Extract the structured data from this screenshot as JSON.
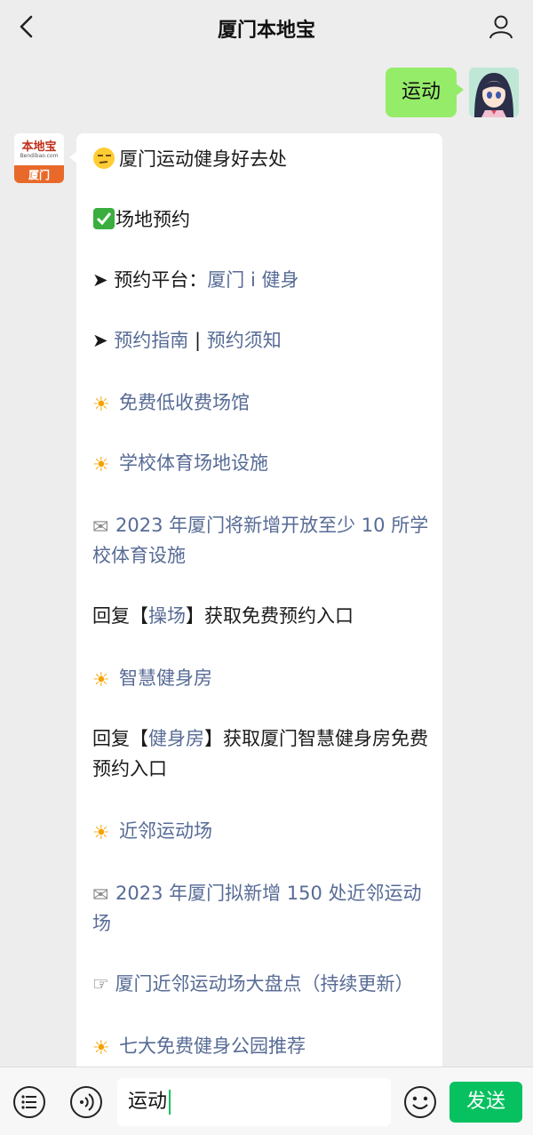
{
  "header": {
    "title": "厦门本地宝"
  },
  "outgoing": {
    "text": "运动"
  },
  "bot_avatar": {
    "top": "本地宝",
    "domain": "Bendibao.com",
    "city": "厦门"
  },
  "message": {
    "title": "厦门运动健身好去处",
    "booking_head": "场地预约",
    "platform_prefix": "预约平台：",
    "platform_link": "厦门 i 健身",
    "guide_link": "预约指南",
    "separator": "|",
    "notice_link": "预约须知",
    "free_venues": "免费低收费场馆",
    "school_head": "学校体育场地设施",
    "school_news": "2023 年厦门将新增开放至少 10 所学校体育设施",
    "reply1_pre": "回复【",
    "reply1_kw": "操场",
    "reply1_post": "】获取免费预约入口",
    "gym_head": "智慧健身房",
    "reply2_pre": "回复【",
    "reply2_kw": "健身房",
    "reply2_post": "】获取厦门智慧健身房免费预约入口",
    "near_head": "近邻运动场",
    "near_news": "2023 年厦门拟新增 150 处近邻运动场",
    "near_list": "厦门近邻运动场大盘点（持续更新）",
    "parks": "七大免费健身公园推荐"
  },
  "input": {
    "value": "运动"
  },
  "send": {
    "label": "发送"
  },
  "colors": {
    "accent": "#07c160",
    "bubble_out": "#95ec69",
    "link": "#576b95"
  }
}
